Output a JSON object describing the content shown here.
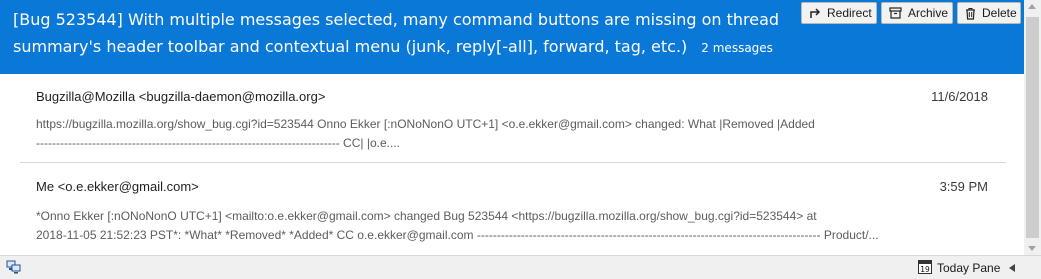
{
  "header": {
    "subject": "[Bug 523544] With multiple messages selected, many command buttons are missing on thread summary's header toolbar and contextual menu (junk, reply[-all], forward, tag, etc.)",
    "message_count": "2 messages",
    "background": "#0a78d7",
    "buttons": {
      "redirect": "Redirect",
      "archive": "Archive",
      "delete": "Delete"
    }
  },
  "messages": [
    {
      "from": "Bugzilla@Mozilla <bugzilla-daemon@mozilla.org>",
      "date": "11/6/2018",
      "snippet_line1": "https://bugzilla.mozilla.org/show_bug.cgi?id=523544 Onno Ekker [:nONoNonO UTC+1] <o.e.ekker@gmail.com> changed: What |Removed |Added",
      "snippet_line2": "---------------------------------------------------------------------------- CC| |o.e...."
    },
    {
      "from": "Me <o.e.ekker@gmail.com>",
      "date": "3:59 PM",
      "snippet_line1": "*Onno Ekker [:nONoNonO UTC+1] <mailto:o.e.ekker@gmail.com> changed Bug 523544 <https://bugzilla.mozilla.org/show_bug.cgi?id=523544> at",
      "snippet_line2": "2018-11-05 21:52:23 PST*: *What* *Removed* *Added* CC o.e.ekker@gmail.com -------------------------------------------------------------------------------------- Product/..."
    }
  ],
  "statusbar": {
    "today_pane_label": "Today Pane",
    "calendar_day": "19"
  }
}
